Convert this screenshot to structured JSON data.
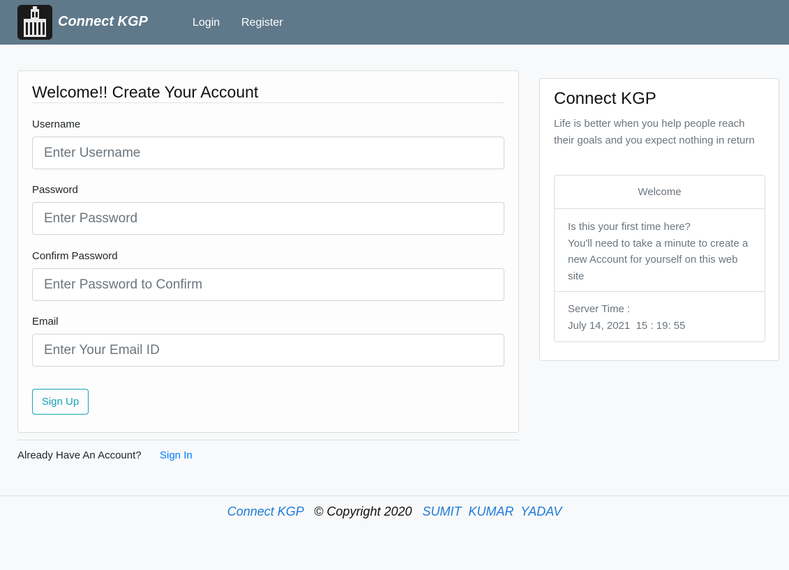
{
  "navbar": {
    "brand": "Connect KGP",
    "links": [
      "Login",
      "Register"
    ],
    "bg_color": "#5f788a"
  },
  "signup": {
    "title": "Welcome!! Create Your Account",
    "fields": [
      {
        "label": "Username",
        "placeholder": "Enter Username"
      },
      {
        "label": "Password",
        "placeholder": "Enter Password"
      },
      {
        "label": "Confirm Password",
        "placeholder": "Enter Password to Confirm"
      },
      {
        "label": "Email",
        "placeholder": "Enter Your Email ID"
      }
    ],
    "button": "Sign Up",
    "already_text": "Already Have An Account?",
    "signin_link": "Sign In"
  },
  "sidebar": {
    "title": "Connect KGP",
    "quote": "Life is better when you help people reach their goals and you expect nothing in return",
    "card": {
      "header": "Welcome",
      "body_line1": "Is this your first time here?",
      "body_line2": "You'll need to take a minute to create a new Account for yourself on this web site",
      "server_label": "Server Time :",
      "server_time": "July 14, 2021  15 : 19: 55"
    }
  },
  "footer": {
    "site": "Connect KGP",
    "copyright": "© Copyright 2020",
    "author": "SUMIT  KUMAR  YADAV"
  },
  "colors": {
    "accent_teal": "#17a2b8",
    "link_blue": "#007bff"
  }
}
